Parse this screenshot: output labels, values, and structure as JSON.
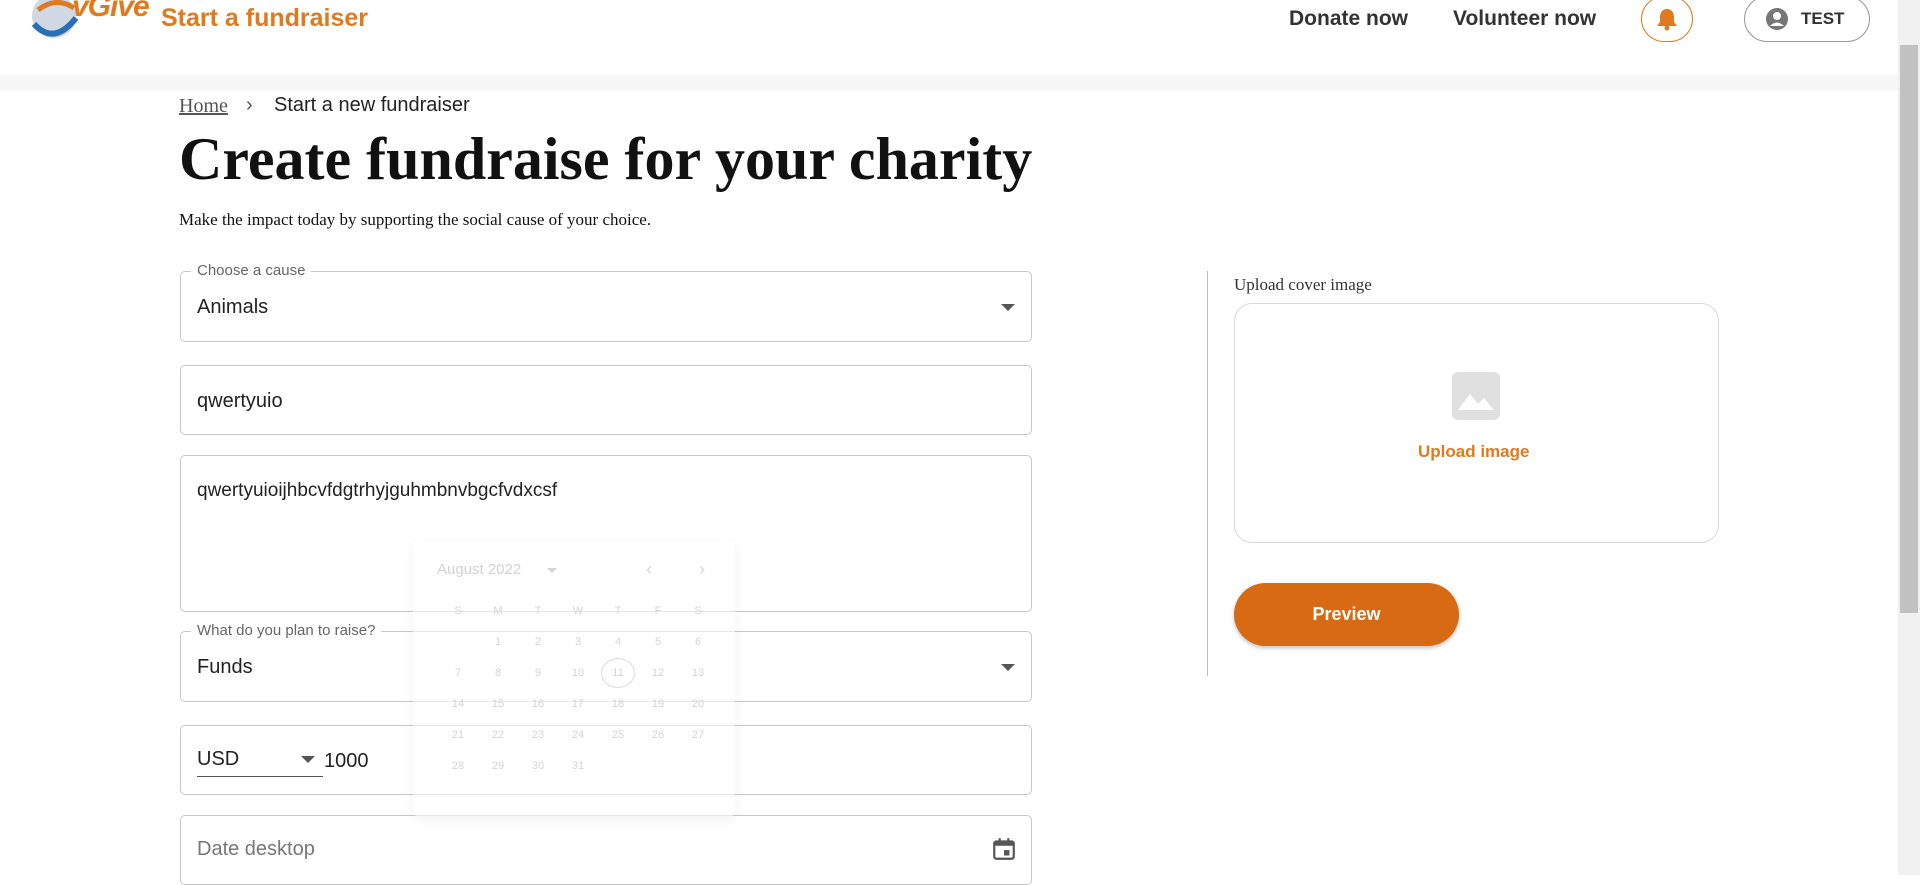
{
  "header": {
    "logo_text": "vGive",
    "title": "Start a fundraiser",
    "nav": [
      "Donate now",
      "Volunteer now"
    ],
    "user_name": "TEST"
  },
  "breadcrumb": {
    "home": "Home",
    "current": "Start a new fundraiser"
  },
  "page": {
    "title": "Create fundraise for your charity",
    "subtitle": "Make the impact today by supporting the social cause of your choice."
  },
  "form": {
    "cause": {
      "label": "Choose a cause",
      "value": "Animals"
    },
    "name": {
      "value": "qwertyuio"
    },
    "description": {
      "value": "qwertyuioijhbcvfdgtrhyjguhmbnvbgcfvdxcsf"
    },
    "plan": {
      "label": "What do you plan to raise?",
      "value": "Funds"
    },
    "currency": "USD",
    "amount": "1000",
    "date": {
      "placeholder": "Date desktop"
    }
  },
  "datepicker": {
    "month_label": "August 2022",
    "weekdays": [
      "S",
      "M",
      "T",
      "W",
      "T",
      "F",
      "S"
    ],
    "days": [
      "",
      "1",
      "2",
      "3",
      "4",
      "5",
      "6",
      "7",
      "8",
      "9",
      "10",
      "11",
      "12",
      "13",
      "14",
      "15",
      "16",
      "17",
      "18",
      "19",
      "20",
      "21",
      "22",
      "23",
      "24",
      "25",
      "26",
      "27",
      "28",
      "29",
      "30",
      "31",
      "",
      "",
      ""
    ],
    "today": "11"
  },
  "upload": {
    "label": "Upload cover image",
    "button": "Upload image"
  },
  "actions": {
    "preview": "Preview"
  },
  "colors": {
    "accent": "#e07a1f",
    "button": "#d86a14"
  }
}
